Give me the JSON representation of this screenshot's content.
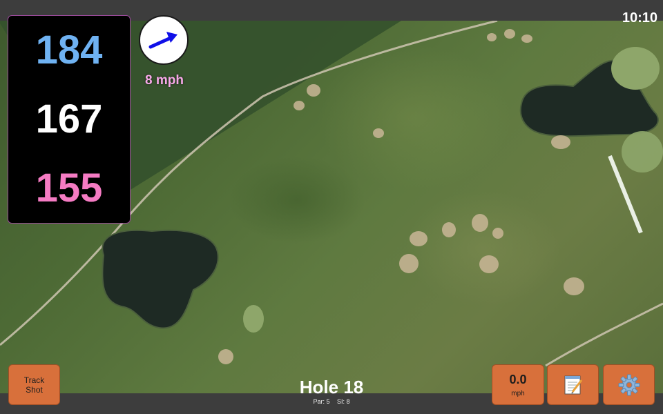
{
  "status_bar": {
    "time": "10:10"
  },
  "distances": {
    "back": "184",
    "middle": "167",
    "front": "155"
  },
  "wind": {
    "speed_label": "8 mph",
    "direction_icon": "wind-arrow-icon",
    "arrow_color": "#1010e8"
  },
  "buttons": {
    "track_shot_line1": "Track",
    "track_shot_line2": "Shot",
    "speed_value": "0.0",
    "speed_unit": "mph",
    "notes_icon": "notepad-icon",
    "settings_icon": "gear-icon"
  },
  "hole": {
    "title": "Hole 18",
    "par": "Par: 5",
    "si": "SI: 8"
  },
  "colors": {
    "back_distance": "#6fb2f2",
    "middle_distance": "#ffffff",
    "front_distance": "#f57bc3",
    "button_bg": "#d8703b",
    "wind_text": "#f7a8e8"
  }
}
